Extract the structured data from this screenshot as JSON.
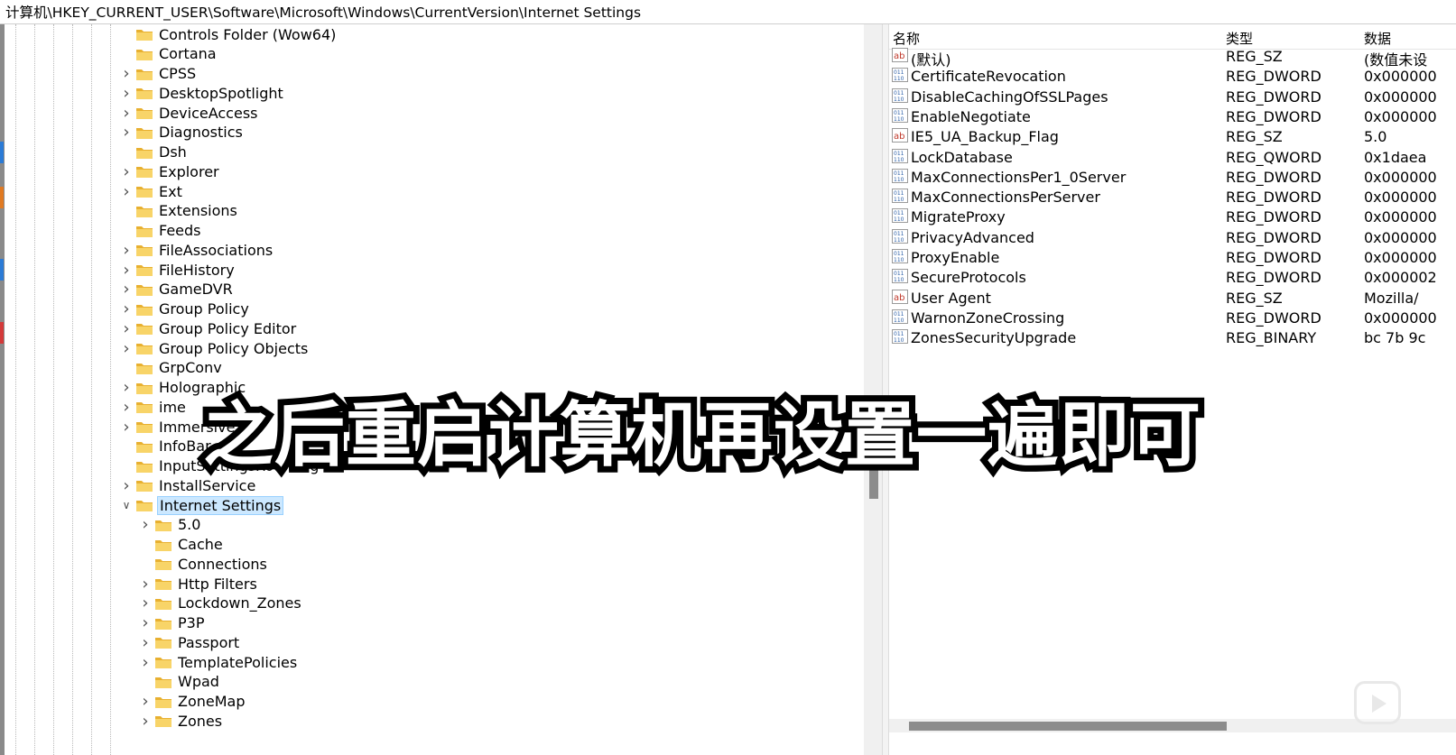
{
  "address_bar": {
    "path": "计算机\\HKEY_CURRENT_USER\\Software\\Microsoft\\Windows\\CurrentVersion\\Internet Settings"
  },
  "tree": {
    "items": [
      {
        "label": "Controls Folder (Wow64)",
        "level": 1,
        "expandable": false
      },
      {
        "label": "Cortana",
        "level": 1,
        "expandable": false
      },
      {
        "label": "CPSS",
        "level": 1,
        "expandable": true
      },
      {
        "label": "DesktopSpotlight",
        "level": 1,
        "expandable": true
      },
      {
        "label": "DeviceAccess",
        "level": 1,
        "expandable": true
      },
      {
        "label": "Diagnostics",
        "level": 1,
        "expandable": true
      },
      {
        "label": "Dsh",
        "level": 1,
        "expandable": false
      },
      {
        "label": "Explorer",
        "level": 1,
        "expandable": true
      },
      {
        "label": "Ext",
        "level": 1,
        "expandable": true
      },
      {
        "label": "Extensions",
        "level": 1,
        "expandable": false
      },
      {
        "label": "Feeds",
        "level": 1,
        "expandable": false
      },
      {
        "label": "FileAssociations",
        "level": 1,
        "expandable": true
      },
      {
        "label": "FileHistory",
        "level": 1,
        "expandable": true
      },
      {
        "label": "GameDVR",
        "level": 1,
        "expandable": true
      },
      {
        "label": "Group Policy",
        "level": 1,
        "expandable": true
      },
      {
        "label": "Group Policy Editor",
        "level": 1,
        "expandable": true
      },
      {
        "label": "Group Policy Objects",
        "level": 1,
        "expandable": true
      },
      {
        "label": "GrpConv",
        "level": 1,
        "expandable": false
      },
      {
        "label": "Holographic",
        "level": 1,
        "expandable": true
      },
      {
        "label": "ime",
        "level": 1,
        "expandable": true
      },
      {
        "label": "ImmersiveSh",
        "level": 1,
        "expandable": true
      },
      {
        "label": "InfoBar",
        "level": 1,
        "expandable": false
      },
      {
        "label": "InputSettingsRoaming",
        "level": 1,
        "expandable": false
      },
      {
        "label": "InstallService",
        "level": 1,
        "expandable": true
      },
      {
        "label": "Internet Settings",
        "level": 1,
        "expandable": true,
        "expanded": true,
        "selected": true
      },
      {
        "label": "5.0",
        "level": 2,
        "expandable": true
      },
      {
        "label": "Cache",
        "level": 2,
        "expandable": false
      },
      {
        "label": "Connections",
        "level": 2,
        "expandable": false
      },
      {
        "label": "Http Filters",
        "level": 2,
        "expandable": true
      },
      {
        "label": "Lockdown_Zones",
        "level": 2,
        "expandable": true
      },
      {
        "label": "P3P",
        "level": 2,
        "expandable": true
      },
      {
        "label": "Passport",
        "level": 2,
        "expandable": true
      },
      {
        "label": "TemplatePolicies",
        "level": 2,
        "expandable": true
      },
      {
        "label": "Wpad",
        "level": 2,
        "expandable": false
      },
      {
        "label": "ZoneMap",
        "level": 2,
        "expandable": true
      },
      {
        "label": "Zones",
        "level": 2,
        "expandable": true
      }
    ]
  },
  "values_pane": {
    "columns": {
      "name": "名称",
      "type": "类型",
      "data": "数据"
    },
    "rows": [
      {
        "name": "(默认)",
        "type": "REG_SZ",
        "data": "(数值未设",
        "icon": "string-value-icon"
      },
      {
        "name": "CertificateRevocation",
        "type": "REG_DWORD",
        "data": "0x000000",
        "icon": "binary-value-icon"
      },
      {
        "name": "DisableCachingOfSSLPages",
        "type": "REG_DWORD",
        "data": "0x000000",
        "icon": "binary-value-icon"
      },
      {
        "name": "EnableNegotiate",
        "type": "REG_DWORD",
        "data": "0x000000",
        "icon": "binary-value-icon"
      },
      {
        "name": "IE5_UA_Backup_Flag",
        "type": "REG_SZ",
        "data": "5.0",
        "icon": "string-value-icon"
      },
      {
        "name": "LockDatabase",
        "type": "REG_QWORD",
        "data": "0x1daea",
        "icon": "binary-value-icon"
      },
      {
        "name": "MaxConnectionsPer1_0Server",
        "type": "REG_DWORD",
        "data": "0x000000",
        "icon": "binary-value-icon"
      },
      {
        "name": "MaxConnectionsPerServer",
        "type": "REG_DWORD",
        "data": "0x000000",
        "icon": "binary-value-icon"
      },
      {
        "name": "MigrateProxy",
        "type": "REG_DWORD",
        "data": "0x000000",
        "icon": "binary-value-icon"
      },
      {
        "name": "PrivacyAdvanced",
        "type": "REG_DWORD",
        "data": "0x000000",
        "icon": "binary-value-icon"
      },
      {
        "name": "ProxyEnable",
        "type": "REG_DWORD",
        "data": "0x000000",
        "icon": "binary-value-icon"
      },
      {
        "name": "SecureProtocols",
        "type": "REG_DWORD",
        "data": "0x000002",
        "icon": "binary-value-icon"
      },
      {
        "name": "User Agent",
        "type": "REG_SZ",
        "data": "Mozilla/",
        "icon": "string-value-icon"
      },
      {
        "name": "WarnonZoneCrossing",
        "type": "REG_DWORD",
        "data": "0x000000",
        "icon": "binary-value-icon"
      },
      {
        "name": "ZonesSecurityUpgrade",
        "type": "REG_BINARY",
        "data": "bc 7b 9c",
        "icon": "binary-value-icon"
      }
    ]
  },
  "subtitle": {
    "text": "之后重启计算机再设置一遍即可"
  },
  "colors": {
    "selection_bg": "#cce8ff",
    "selection_border": "#99d1ff",
    "folder": "#f5c542",
    "scroll_thumb": "#8c8c8c"
  }
}
